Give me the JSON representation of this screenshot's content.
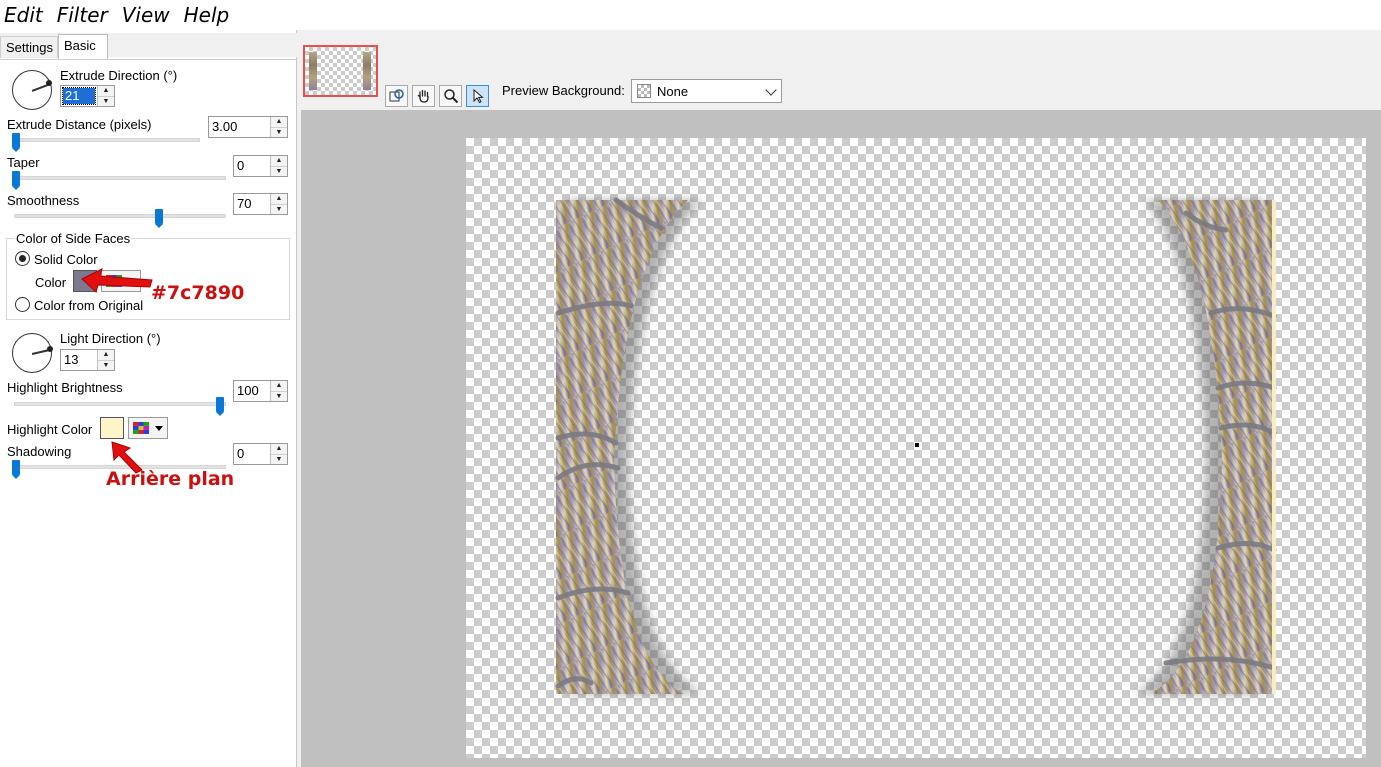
{
  "menu": {
    "items": [
      "Edit",
      "Filter",
      "View",
      "Help"
    ]
  },
  "tabs": {
    "settings": "Settings",
    "basic": "Basic"
  },
  "controls": {
    "extrude_direction": {
      "label": "Extrude Direction (°)",
      "value": "21"
    },
    "extrude_distance": {
      "label": "Extrude Distance (pixels)",
      "value": "3.00",
      "slider": 0.0
    },
    "taper": {
      "label": "Taper",
      "value": "0",
      "slider": 0.0
    },
    "smoothness": {
      "label": "Smoothness",
      "value": "70",
      "slider": 0.7
    },
    "side_faces": {
      "title": "Color of Side Faces",
      "solid_color": "Solid Color",
      "color_label": "Color",
      "color_value": "#7c7890",
      "from_original": "Color from Original"
    },
    "light_direction": {
      "label": "Light Direction (°)",
      "value": "13"
    },
    "highlight_brightness": {
      "label": "Highlight Brightness",
      "value": "100",
      "slider": 1.0
    },
    "highlight_color": {
      "label": "Highlight Color",
      "color_value": "#fdf5c8"
    },
    "shadowing": {
      "label": "Shadowing",
      "value": "0",
      "slider": 0.0
    }
  },
  "annotations": {
    "color_hex": "#7c7890",
    "background_note": "Arrière plan"
  },
  "preview": {
    "background_label": "Preview Background:",
    "background_value": "None"
  },
  "icons": [
    "dial-icon",
    "spin-up-icon",
    "spin-down-icon",
    "palette-icon",
    "dropdown-arrow-icon",
    "pan-hand-icon",
    "zoom-icon",
    "pointer-icon",
    "proof-icon",
    "red-arrow-icon"
  ]
}
